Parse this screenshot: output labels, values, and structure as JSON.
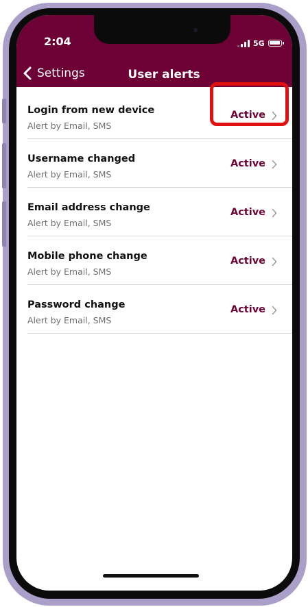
{
  "status_bar": {
    "time": "2:04",
    "network": "5G"
  },
  "nav": {
    "back_label": "Settings",
    "title": "User alerts"
  },
  "alerts": [
    {
      "title": "Login from new device",
      "subtitle": "Alert by Email, SMS",
      "status": "Active"
    },
    {
      "title": "Username changed",
      "subtitle": "Alert by Email, SMS",
      "status": "Active"
    },
    {
      "title": "Email address change",
      "subtitle": "Alert by Email, SMS",
      "status": "Active"
    },
    {
      "title": "Mobile phone change",
      "subtitle": "Alert by Email, SMS",
      "status": "Active"
    },
    {
      "title": "Password change",
      "subtitle": "Alert by Email, SMS",
      "status": "Active"
    }
  ],
  "colors": {
    "brand": "#6d0135",
    "highlight": "#e01010",
    "frame": "#a99fc9"
  },
  "icons": {
    "back": "chevron-left-icon",
    "row": "chevron-right-icon",
    "signal": "signal-bars-icon",
    "battery": "battery-icon"
  }
}
